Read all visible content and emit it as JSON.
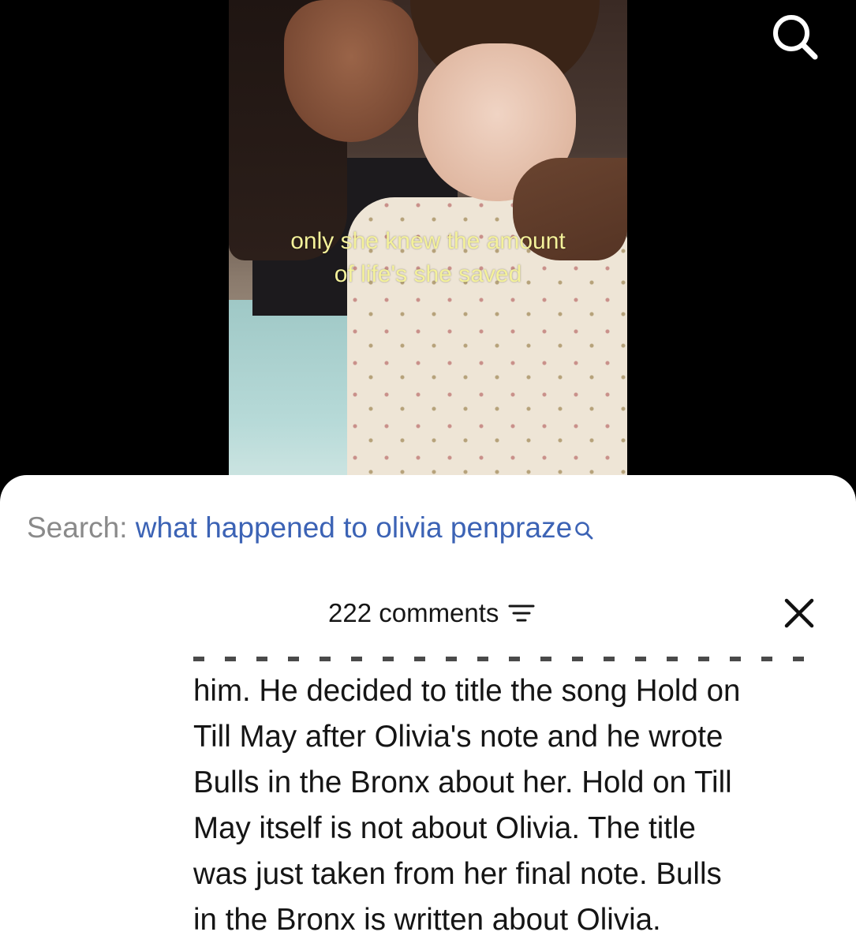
{
  "video": {
    "caption_lines": [
      "only she knew the amount",
      "of life's she saved"
    ]
  },
  "icons": {
    "top_search": "search-icon",
    "close": "close-icon",
    "filter": "filter-lines-icon",
    "inline_search": "search-icon"
  },
  "search": {
    "prefix": "Search: ",
    "query": "what happened to olivia penpraze"
  },
  "comments": {
    "count_label": "222 comments",
    "visible_comment_lines": [
      "him. He decided to title the song Hold on",
      "Till May after Olivia's note and he wrote",
      "Bulls in the Bronx about her. Hold on Till",
      "May itself is not about Olivia. The title",
      "was just taken from her final note. Bulls",
      "in the Bronx is written about Olivia."
    ]
  },
  "colors": {
    "search_prefix": "#8a8a8a",
    "search_query": "#3c63b5",
    "caption": "#f4f19a",
    "sheet_bg": "#ffffff",
    "video_bg": "#000000"
  }
}
